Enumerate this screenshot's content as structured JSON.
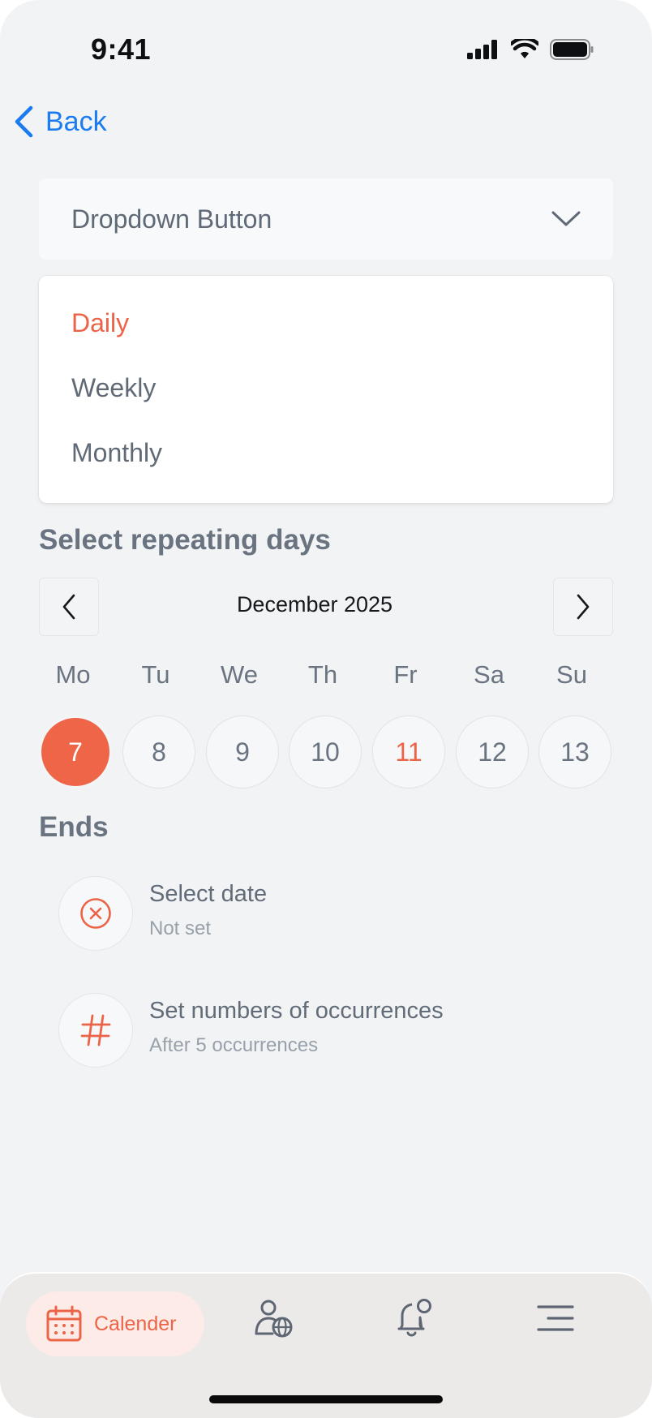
{
  "status_bar": {
    "time": "9:41"
  },
  "nav": {
    "back_label": "Back"
  },
  "dropdown": {
    "button_label": "Dropdown Button",
    "options": [
      "Daily",
      "Weekly",
      "Monthly"
    ],
    "selected": "Daily"
  },
  "repeat": {
    "heading": "Select repeating days",
    "month_label": "December 2025",
    "weekdays": [
      "Mo",
      "Tu",
      "We",
      "Th",
      "Fr",
      "Sa",
      "Su"
    ],
    "days": [
      "7",
      "8",
      "9",
      "10",
      "11",
      "12",
      "13"
    ],
    "selected_day": "7",
    "highlighted_day": "11"
  },
  "ends": {
    "heading": "Ends",
    "options": [
      {
        "title": "Select date",
        "subtitle": "Not set",
        "icon": "cancel-circle-icon"
      },
      {
        "title": "Set numbers of occurrences",
        "subtitle": "After 5 occurrences",
        "icon": "hash-icon"
      }
    ]
  },
  "tabbar": {
    "items": [
      {
        "label": "Calender",
        "icon": "calendar-icon",
        "active": true
      },
      {
        "icon": "user-globe-icon"
      },
      {
        "icon": "bell-notification-icon"
      },
      {
        "icon": "menu-icon"
      }
    ]
  },
  "colors": {
    "accent": "#ec6447",
    "link": "#1a7cf0",
    "text": "#606a77",
    "background": "#f2f3f5"
  }
}
